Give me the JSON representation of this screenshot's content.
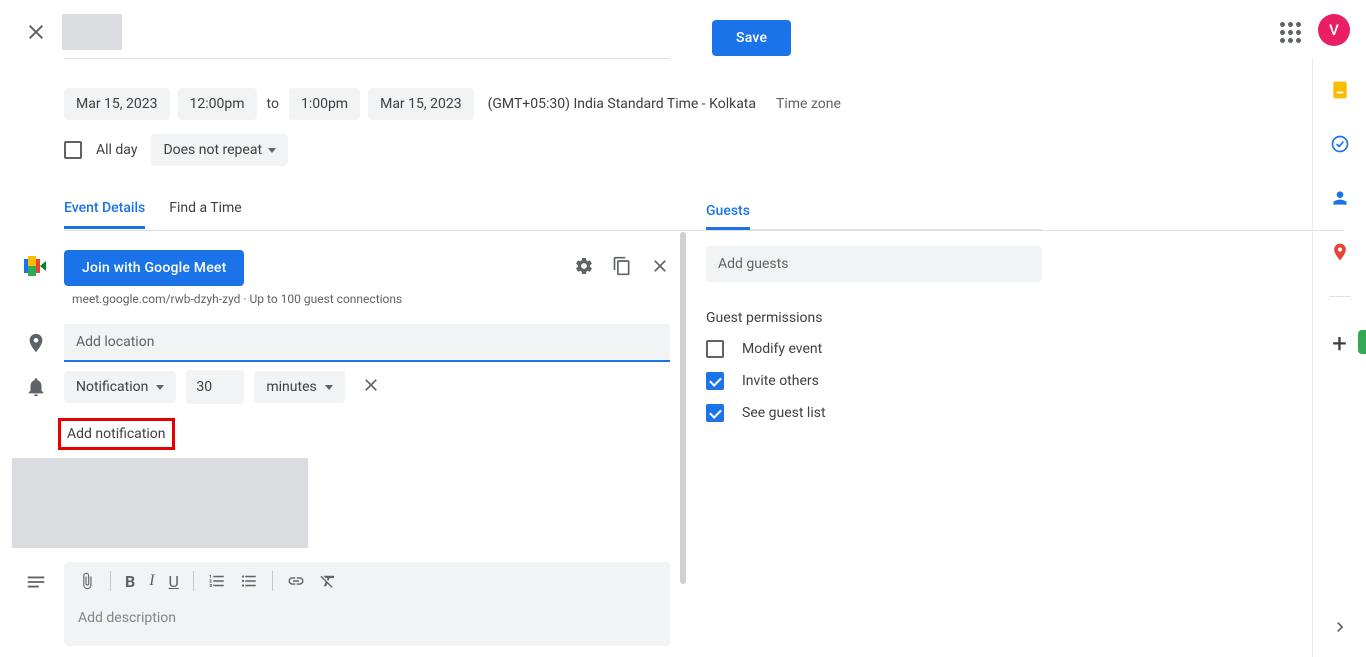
{
  "header": {
    "save_label": "Save",
    "avatar_initial": "V"
  },
  "datetime": {
    "start_date": "Mar 15, 2023",
    "start_time": "12:00pm",
    "to_label": "to",
    "end_time": "1:00pm",
    "end_date": "Mar 15, 2023",
    "tz_text": "(GMT+05:30) India Standard Time - Kolkata",
    "tz_link": "Time zone"
  },
  "allday": {
    "label": "All day",
    "repeat": "Does not repeat"
  },
  "tabs": {
    "details": "Event Details",
    "findtime": "Find a Time"
  },
  "meet": {
    "button": "Join with Google Meet",
    "sub": "meet.google.com/rwb-dzyh-zyd · Up to 100 guest connections"
  },
  "location": {
    "placeholder": "Add location",
    "value": ""
  },
  "notification": {
    "type": "Notification",
    "value": "30",
    "unit": "minutes",
    "add_label": "Add notification"
  },
  "description": {
    "placeholder": "Add description"
  },
  "guests": {
    "tab": "Guests",
    "placeholder": "Add guests",
    "perm_title": "Guest permissions",
    "modify": "Modify event",
    "invite": "Invite others",
    "seelist": "See guest list"
  }
}
